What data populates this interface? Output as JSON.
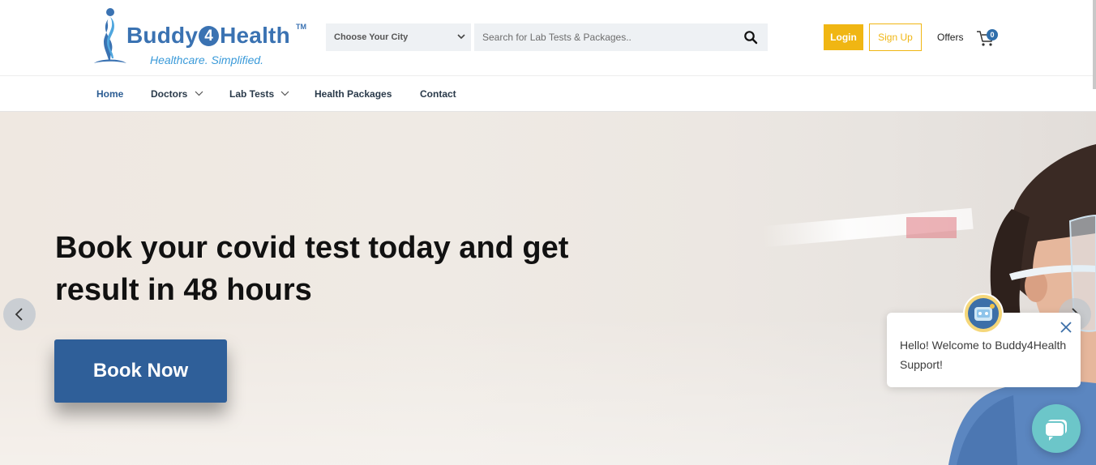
{
  "brand": {
    "name_prefix": "Buddy",
    "name_digit": "4",
    "name_suffix": "Health",
    "trademark": "TM",
    "tagline": "Healthcare. Simplified.",
    "color": "#3a72b2"
  },
  "header": {
    "city_select": {
      "selected": "Choose Your City"
    },
    "search": {
      "placeholder": "Search for Lab Tests & Packages.."
    },
    "login_label": "Login",
    "signup_label": "Sign Up",
    "offers_label": "Offers",
    "cart_count": "0",
    "accent_color": "#f0b613"
  },
  "nav": {
    "items": [
      {
        "label": "Home",
        "active": true,
        "dropdown": false
      },
      {
        "label": "Doctors",
        "active": false,
        "dropdown": true
      },
      {
        "label": "Lab Tests",
        "active": false,
        "dropdown": true
      },
      {
        "label": "Health Packages",
        "active": false,
        "dropdown": false
      },
      {
        "label": "Contact",
        "active": false,
        "dropdown": false
      }
    ]
  },
  "hero": {
    "title_line1": "Book your covid test today and get",
    "title_line2": "result in 48 hours",
    "cta_label": "Book Now",
    "cta_color": "#2f5f99",
    "prev_icon": "chevron-left-icon",
    "next_icon": "chevron-right-icon"
  },
  "chat": {
    "greeting_line1": "Hello! Welcome to Buddy4Health",
    "greeting_line2": "Support!",
    "launcher_color": "#6cc6c9"
  }
}
